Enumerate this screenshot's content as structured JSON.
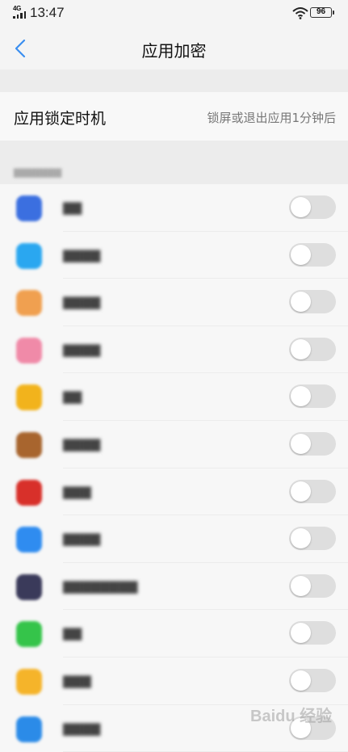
{
  "status_bar": {
    "network": "4G",
    "time": "13:47",
    "battery": "96"
  },
  "header": {
    "title": "应用加密"
  },
  "lock_timing": {
    "label": "应用锁定时机",
    "value": "锁屏或退出应用1分钟后"
  },
  "apps": [
    {
      "icon": "baidu-icon",
      "color": "#3b6fe0",
      "enabled": false
    },
    {
      "icon": "baidu-translate-icon",
      "color": "#2aa7f0",
      "enabled": false
    },
    {
      "icon": "baidu-netdisk-icon",
      "color": "#f0a050",
      "enabled": false
    },
    {
      "icon": "bilibili-icon",
      "color": "#f08aa8",
      "enabled": false
    },
    {
      "icon": "notes-icon",
      "color": "#f2b31c",
      "enabled": false
    },
    {
      "icon": "game-icon",
      "color": "#a8652e",
      "enabled": false
    },
    {
      "icon": "red-app-icon",
      "color": "#d8302a",
      "enabled": false
    },
    {
      "icon": "cloud-drive-icon",
      "color": "#2f8cf0",
      "enabled": false
    },
    {
      "icon": "game-avatar-icon",
      "color": "#3a3a5a",
      "enabled": false
    },
    {
      "icon": "phone-icon",
      "color": "#35c44a",
      "enabled": false
    },
    {
      "icon": "ebook-icon",
      "color": "#f5b42a",
      "enabled": false
    },
    {
      "icon": "email-icon",
      "color": "#2b8be8",
      "enabled": false
    }
  ],
  "watermark": {
    "text": "Baidu 经验"
  }
}
